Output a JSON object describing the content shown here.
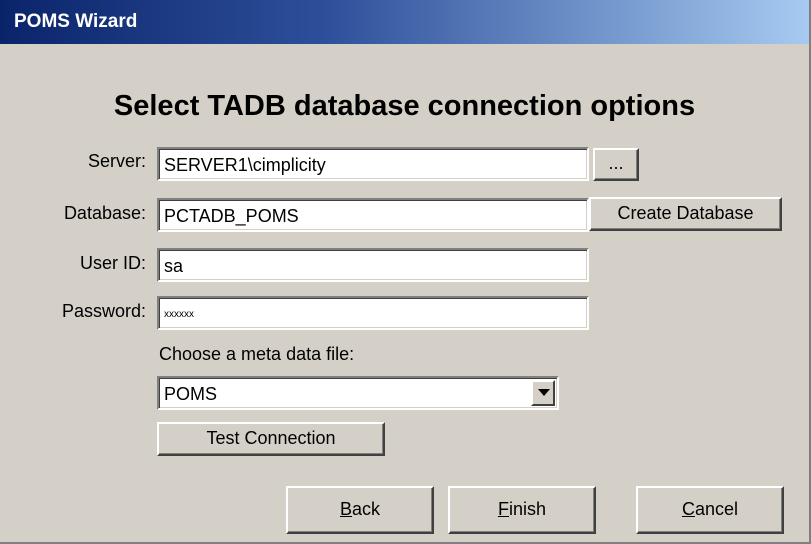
{
  "window": {
    "title": "POMS Wizard"
  },
  "page": {
    "heading": "Select TADB database connection options"
  },
  "form": {
    "server_label": "Server:",
    "server_value": "SERVER1\\cimplicity",
    "browse_label": "...",
    "database_label": "Database:",
    "database_value": "PCTADB_POMS",
    "create_database_label": "Create Database",
    "userid_label": "User ID:",
    "userid_value": "sa",
    "password_label": "Password:",
    "password_value": "xxxxxx",
    "metadata_label": "Choose a meta data file:",
    "metadata_selected": "POMS",
    "test_connection_label": "Test Connection"
  },
  "footer": {
    "back_mnemonic": "B",
    "back_rest": "ack",
    "finish_mnemonic": "F",
    "finish_rest": "inish",
    "cancel_mnemonic": "C",
    "cancel_rest": "ancel"
  },
  "icons": {
    "dropdown_arrow": "chevron-down-icon"
  },
  "colors": {
    "dialog_background": "#d4d0c8",
    "titlebar_start": "#0a246a",
    "titlebar_end": "#a6caf0"
  }
}
